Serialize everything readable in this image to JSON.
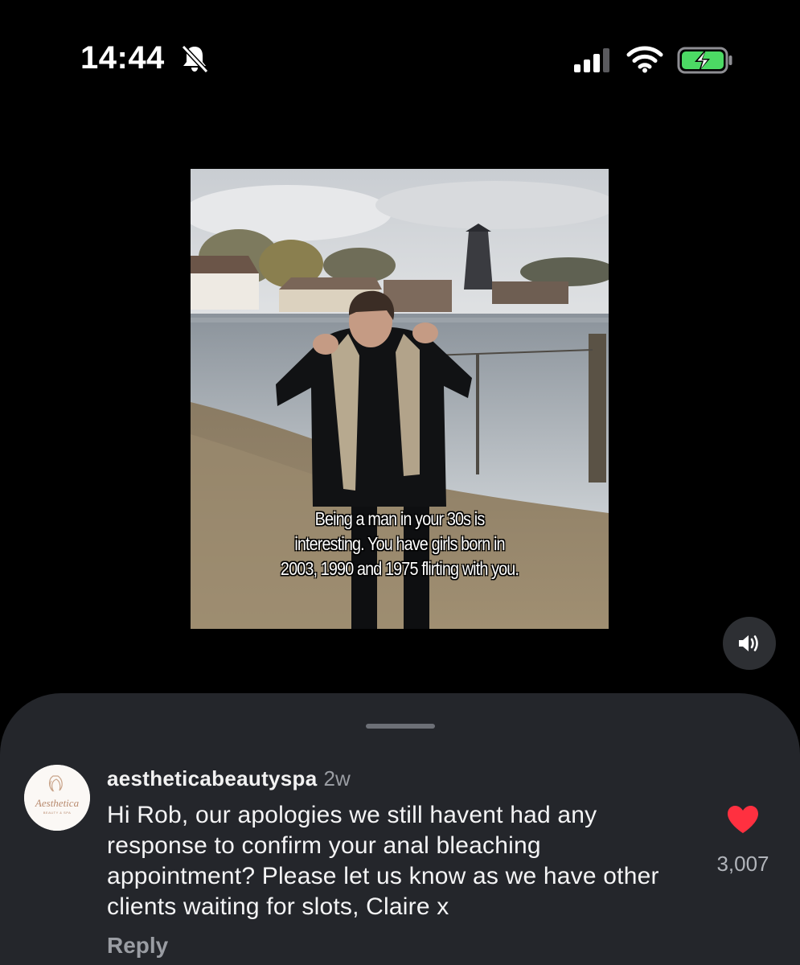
{
  "status_bar": {
    "time": "14:44",
    "mute_icon": "bell-slash-icon",
    "signal_icon": "cellular-signal-icon",
    "wifi_icon": "wifi-icon",
    "battery_icon": "battery-charging-icon",
    "battery_color": "#4cd964"
  },
  "media": {
    "caption": "Being a man in your 30s is\ninteresting. You have girls born in\n2003, 1990 and 1975 flirting with you.",
    "sound_icon": "speaker-sound-on-icon"
  },
  "comments": {
    "grabber_icon": "sheet-grabber",
    "items": [
      {
        "username": "aestheticabeautyspa",
        "time_ago": "2w",
        "avatar_logo_text": "Aesthetica",
        "avatar_logo_subtext": "BEAUTY & SPA",
        "text": "Hi Rob, our apologies we still havent had any response to confirm your anal bleaching appointment? Please let us know as we have other clients waiting for slots, Claire x",
        "reply_label": "Reply",
        "like_icon": "heart-filled-icon",
        "like_color": "#ff3040",
        "like_count": "3,007"
      }
    ]
  }
}
